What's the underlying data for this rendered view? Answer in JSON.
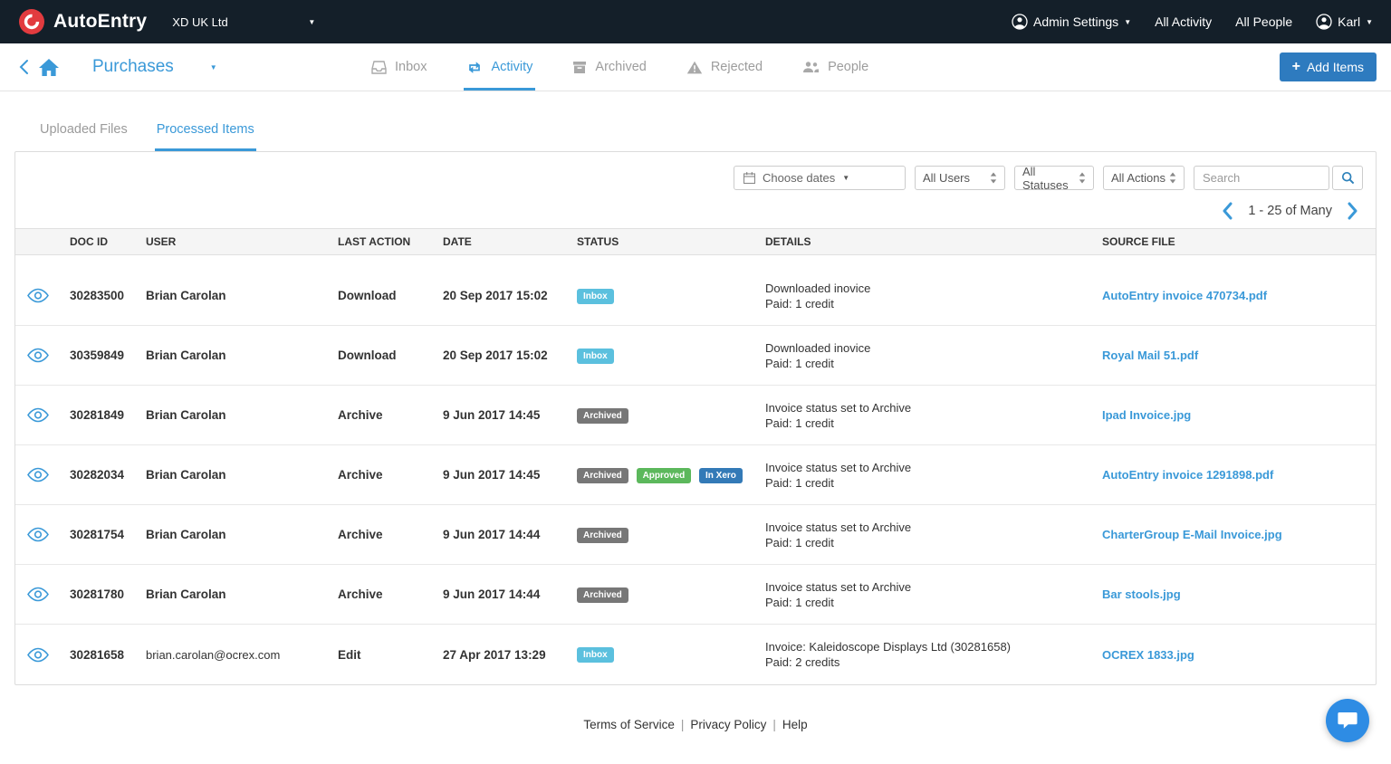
{
  "navbar": {
    "brand": "AutoEntry",
    "company": "XD UK Ltd",
    "admin_settings": "Admin Settings",
    "all_activity": "All Activity",
    "all_people": "All People",
    "user": "Karl"
  },
  "header": {
    "title": "Purchases",
    "add_items_label": "Add Items",
    "tabs": [
      {
        "label": "Inbox",
        "active": false
      },
      {
        "label": "Activity",
        "active": true
      },
      {
        "label": "Archived",
        "active": false
      },
      {
        "label": "Rejected",
        "active": false
      },
      {
        "label": "People",
        "active": false
      }
    ]
  },
  "subtabs": [
    {
      "label": "Uploaded Files",
      "active": false
    },
    {
      "label": "Processed Items",
      "active": true
    }
  ],
  "filters": {
    "choose_dates_label": "Choose dates",
    "users_selected": "All Users",
    "statuses_selected": "All Statuses",
    "actions_selected": "All Actions",
    "search_placeholder": "Search"
  },
  "pagination": {
    "range_label": "1 - 25 of Many"
  },
  "table": {
    "headers": {
      "doc_id": "DOC ID",
      "user": "USER",
      "last_action": "LAST ACTION",
      "date": "DATE",
      "status": "STATUS",
      "details": "DETAILS",
      "source_file": "SOURCE FILE"
    },
    "rows": [
      {
        "doc_id": "30283500",
        "user": "Brian Carolan",
        "action": "Download",
        "date": "20 Sep 2017 15:02",
        "statuses": [
          {
            "label": "Inbox",
            "type": "inbox"
          }
        ],
        "details_1": "Downloaded inovice",
        "details_2": "Paid: 1 credit",
        "source_file": "AutoEntry invoice 470734.pdf"
      },
      {
        "doc_id": "30359849",
        "user": "Brian Carolan",
        "action": "Download",
        "date": "20 Sep 2017 15:02",
        "statuses": [
          {
            "label": "Inbox",
            "type": "inbox"
          }
        ],
        "details_1": "Downloaded inovice",
        "details_2": "Paid: 1 credit",
        "source_file": "Royal Mail 51.pdf"
      },
      {
        "doc_id": "30281849",
        "user": "Brian Carolan",
        "action": "Archive",
        "date": "9 Jun 2017 14:45",
        "statuses": [
          {
            "label": "Archived",
            "type": "archived"
          }
        ],
        "details_1": "Invoice status set to Archive",
        "details_2": "Paid: 1 credit",
        "source_file": "Ipad Invoice.jpg"
      },
      {
        "doc_id": "30282034",
        "user": "Brian Carolan",
        "action": "Archive",
        "date": "9 Jun 2017 14:45",
        "statuses": [
          {
            "label": "Archived",
            "type": "archived"
          },
          {
            "label": "Approved",
            "type": "approved"
          },
          {
            "label": "In Xero",
            "type": "inxero"
          }
        ],
        "details_1": "Invoice status set to Archive",
        "details_2": "Paid: 1 credit",
        "source_file": "AutoEntry invoice 1291898.pdf"
      },
      {
        "doc_id": "30281754",
        "user": "Brian Carolan",
        "action": "Archive",
        "date": "9 Jun 2017 14:44",
        "statuses": [
          {
            "label": "Archived",
            "type": "archived"
          }
        ],
        "details_1": "Invoice status set to Archive",
        "details_2": "Paid: 1 credit",
        "source_file": "CharterGroup E-Mail Invoice.jpg"
      },
      {
        "doc_id": "30281780",
        "user": "Brian Carolan",
        "action": "Archive",
        "date": "9 Jun 2017 14:44",
        "statuses": [
          {
            "label": "Archived",
            "type": "archived"
          }
        ],
        "details_1": "Invoice status set to Archive",
        "details_2": "Paid: 1 credit",
        "source_file": "Bar stools.jpg"
      },
      {
        "doc_id": "30281658",
        "user": "brian.carolan@ocrex.com",
        "action": "Edit",
        "date": "27 Apr 2017 13:29",
        "statuses": [
          {
            "label": "Inbox",
            "type": "inbox"
          }
        ],
        "details_1": "Invoice: Kaleidoscope Displays Ltd (30281658)",
        "details_2": "Paid: 2 credits",
        "source_file": "OCREX 1833.jpg"
      }
    ]
  },
  "footer": {
    "terms": "Terms of Service",
    "privacy": "Privacy Policy",
    "help": "Help"
  },
  "colors": {
    "navbar_bg": "#141f29",
    "accent_blue": "#3a99d8",
    "button_blue": "#2e7bbf",
    "brand_red": "#e23b3f",
    "badge_inbox": "#5bc0de",
    "badge_archived": "#777777",
    "badge_approved": "#5cb85c",
    "badge_in_xero": "#337ab7",
    "chat_blue": "#2e8ce4"
  }
}
